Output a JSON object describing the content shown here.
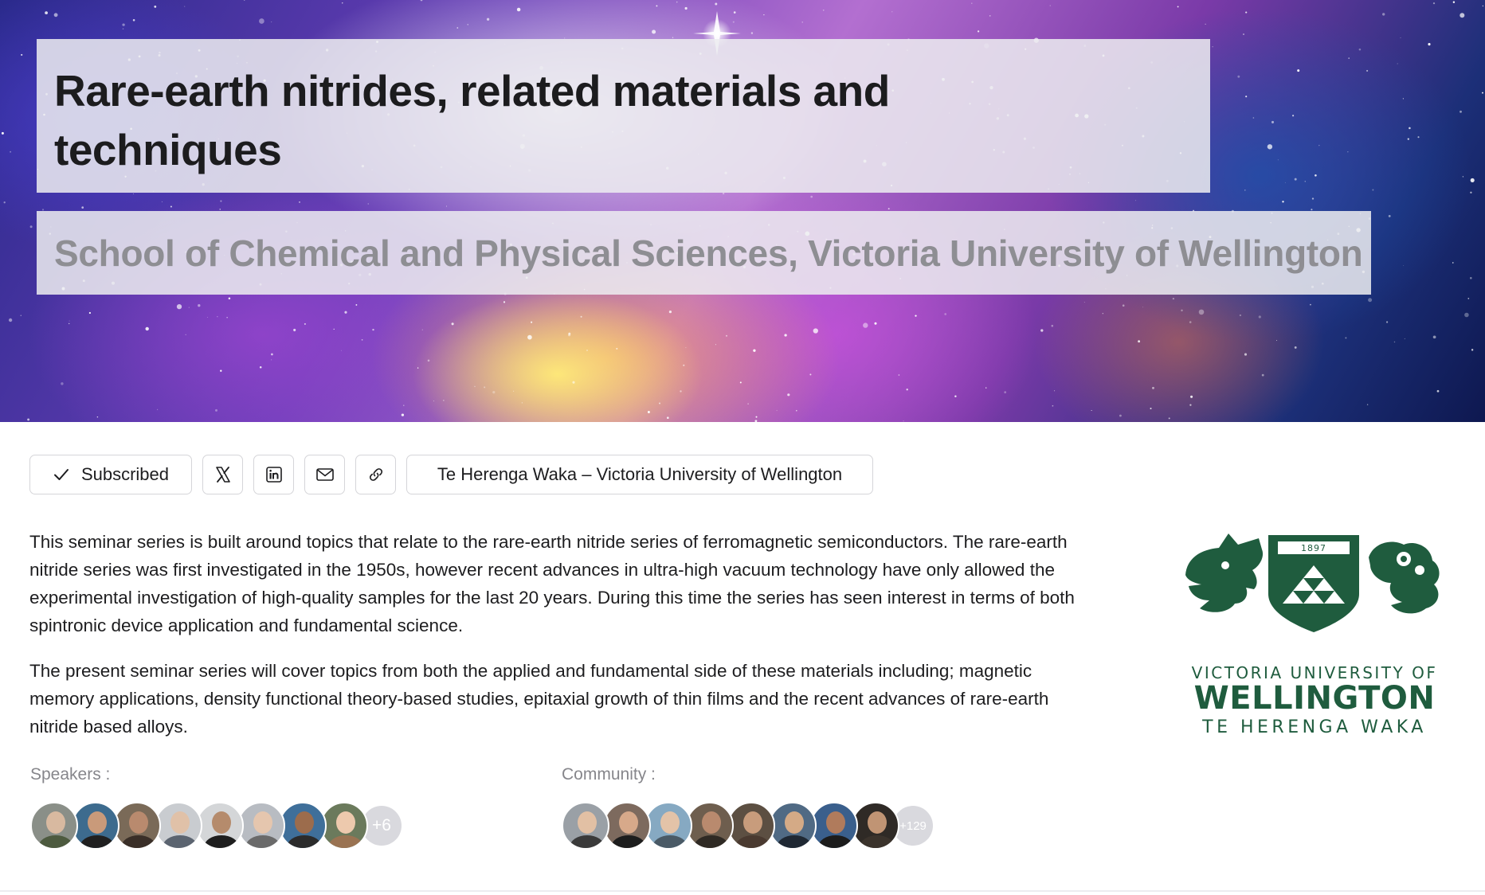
{
  "hero": {
    "title": "Rare-earth nitrides, related materials and techniques",
    "subtitle": "School of Chemical and Physical Sciences, Victoria University of Wellington"
  },
  "actions": {
    "subscribed_label": "Subscribed",
    "x_icon": "x-icon",
    "linkedin_icon": "linkedin-icon",
    "email_icon": "envelope-icon",
    "link_icon": "link-icon",
    "organization_label": "Te Herenga Waka – Victoria University of Wellington"
  },
  "description": {
    "paragraph_1": "This seminar series is built around topics that relate to the rare-earth nitride series of ferromagnetic semiconductors. The rare-earth nitride series was first investigated in the 1950s, however recent advances in ultra-high vacuum technology have only allowed the experimental investigation of high-quality samples for the last 20 years. During this time the series has seen interest in terms of both spintronic device application and fundamental science.",
    "paragraph_2": "The present seminar series will cover topics from both the applied and fundamental side of these materials including; magnetic memory applications, density functional theory-based studies, epitaxial growth of thin films and the recent advances of rare-earth nitride based alloys."
  },
  "logo": {
    "year": "1897",
    "line1": "VICTORIA UNIVERSITY OF",
    "line2": "WELLINGTON",
    "line3": "TE HERENGA WAKA",
    "color": "#1f5c3e"
  },
  "speakers": {
    "label": "Speakers",
    "more": "+6"
  },
  "community": {
    "label": "Community",
    "more": "+129"
  }
}
